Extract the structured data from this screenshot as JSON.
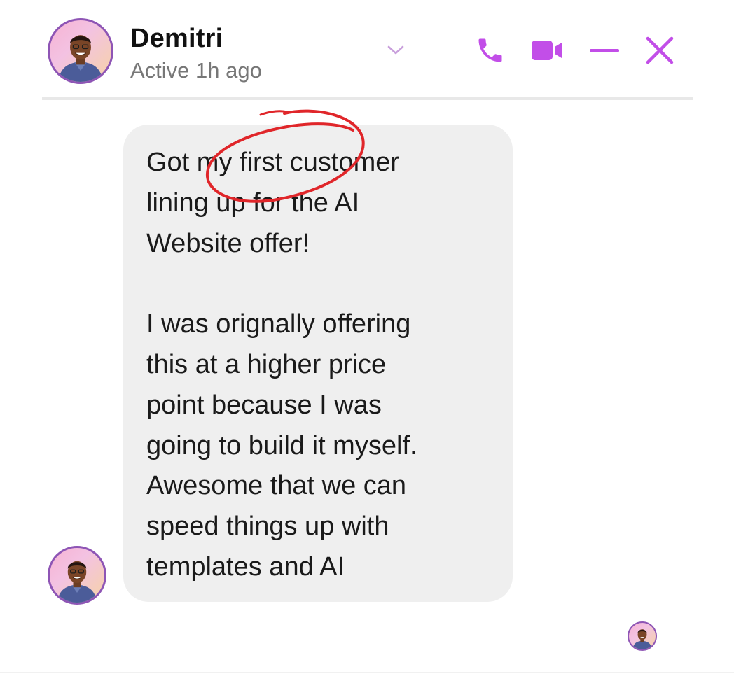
{
  "header": {
    "contact_name": "Demitri",
    "status": "Active 1h ago",
    "icons": {
      "chevron": "chevron-down-icon",
      "call": "phone-icon",
      "video": "video-camera-icon",
      "minimize": "minimize-icon",
      "close": "close-icon"
    }
  },
  "conversation": {
    "messages": [
      {
        "sender": "Demitri",
        "text": "Got my first customer\nlining up for the AI\nWebsite offer!\n\nI was orignally offering\nthis at a higher price\npoint because I was\ngoing to build it myself.\nAwesome that we can\nspeed things up with\ntemplates and AI"
      }
    ]
  },
  "colors": {
    "accent": "#c24ee8",
    "bubble": "#efefef",
    "annotation_circle": "#e0262a",
    "avatar_ring": "#8e55b5"
  }
}
